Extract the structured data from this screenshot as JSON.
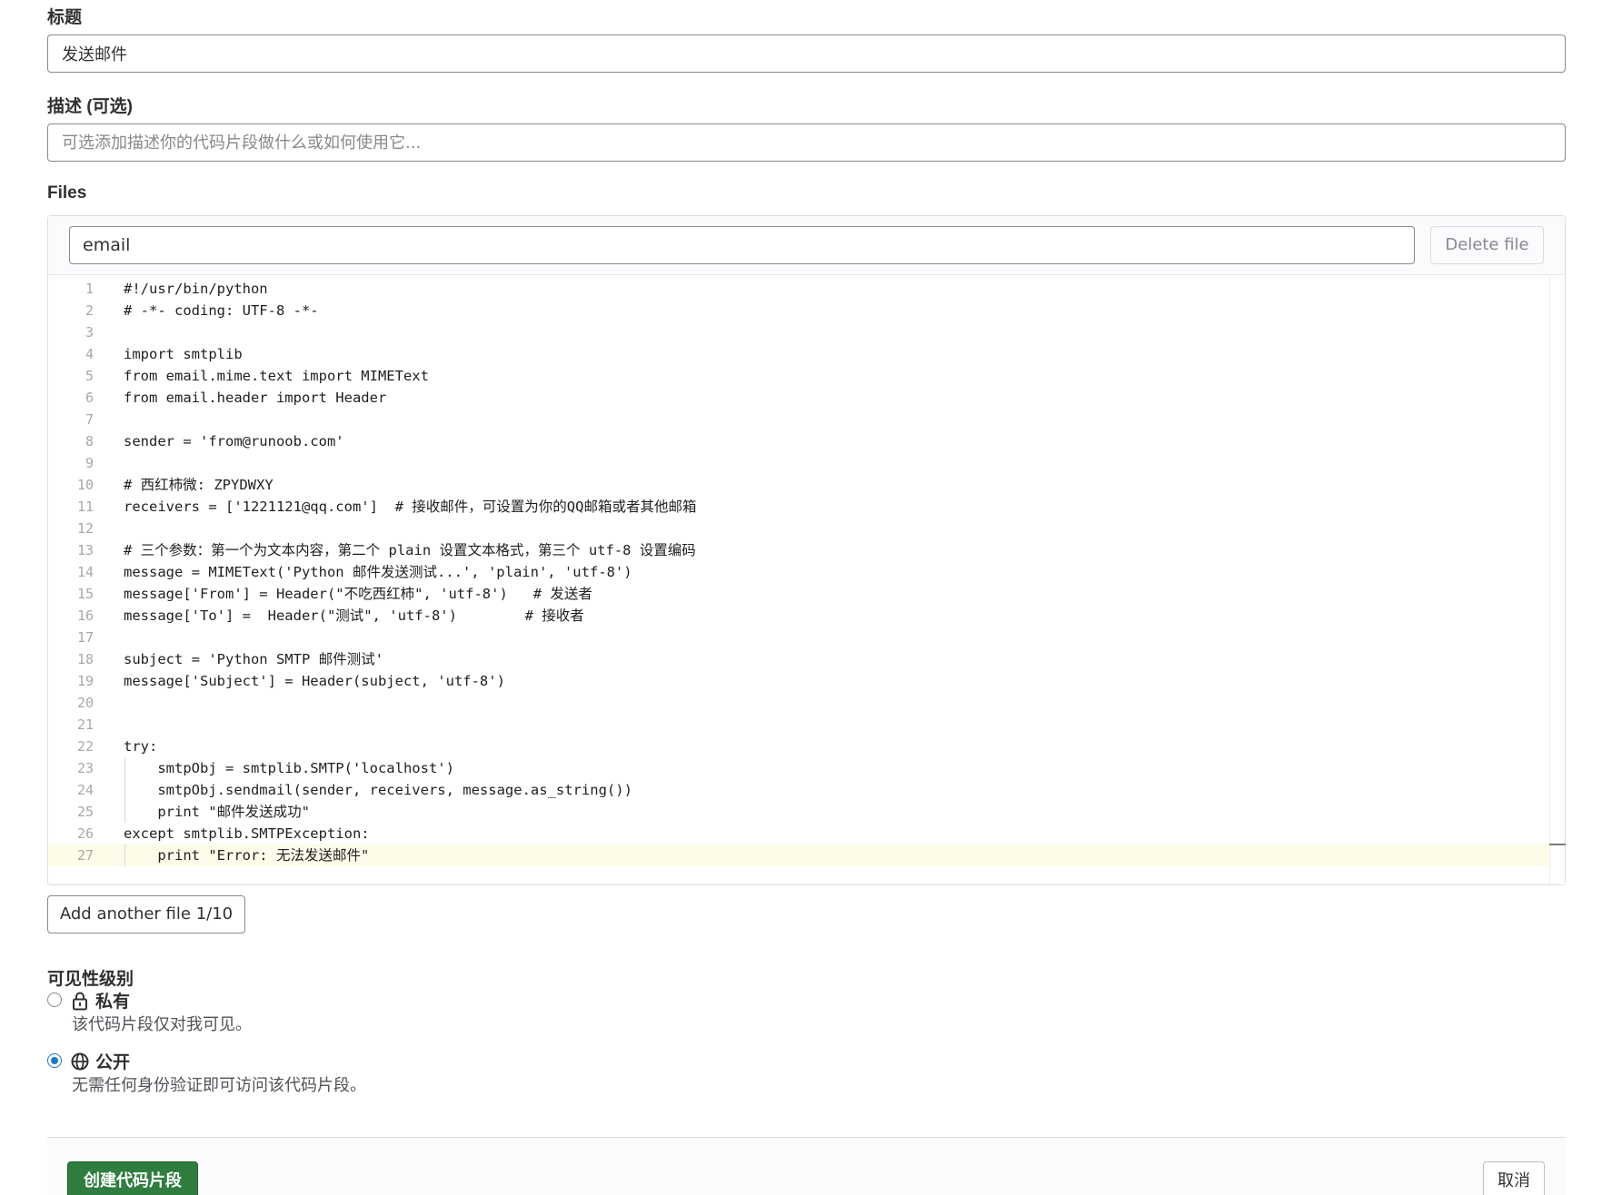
{
  "form": {
    "title_label": "标题",
    "title_value": "发送邮件",
    "description_label": "描述 (可选)",
    "description_placeholder": "可选添加描述你的代码片段做什么或如何使用它...",
    "files_label": "Files"
  },
  "file": {
    "name_value": "email",
    "delete_label": "Delete file",
    "code_lines": [
      "#!/usr/bin/python",
      "# -*- coding: UTF-8 -*-",
      "",
      "import smtplib",
      "from email.mime.text import MIMEText",
      "from email.header import Header",
      "",
      "sender = 'from@runoob.com'",
      "",
      "# 西红柿微: ZPYDWXY",
      "receivers = ['1221121@qq.com']  # 接收邮件，可设置为你的QQ邮箱或者其他邮箱",
      "",
      "# 三个参数：第一个为文本内容，第二个 plain 设置文本格式，第三个 utf-8 设置编码",
      "message = MIMEText('Python 邮件发送测试...', 'plain', 'utf-8')",
      "message['From'] = Header(\"不吃西红柿\", 'utf-8')   # 发送者",
      "message['To'] =  Header(\"测试\", 'utf-8')        # 接收者",
      "",
      "subject = 'Python SMTP 邮件测试'",
      "message['Subject'] = Header(subject, 'utf-8')",
      "",
      "",
      "try:",
      "    smtpObj = smtplib.SMTP('localhost')",
      "    smtpObj.sendmail(sender, receivers, message.as_string())",
      "    print \"邮件发送成功\"",
      "except smtplib.SMTPException:",
      "    print \"Error: 无法发送邮件\""
    ]
  },
  "add_file_label": "Add another file 1/10",
  "visibility": {
    "label": "可见性级别",
    "options": [
      {
        "title": "私有",
        "description": "该代码片段仅对我可见。",
        "icon": "lock-icon",
        "checked": false
      },
      {
        "title": "公开",
        "description": "无需任何身份验证即可访问该代码片段。",
        "icon": "globe-icon",
        "checked": true
      }
    ]
  },
  "footer": {
    "create_label": "创建代码片段",
    "cancel_label": "取消"
  },
  "colors": {
    "primary_button": "#2f7d3f",
    "radio_checked": "#1f75cb",
    "active_line": "#fdfce9"
  }
}
